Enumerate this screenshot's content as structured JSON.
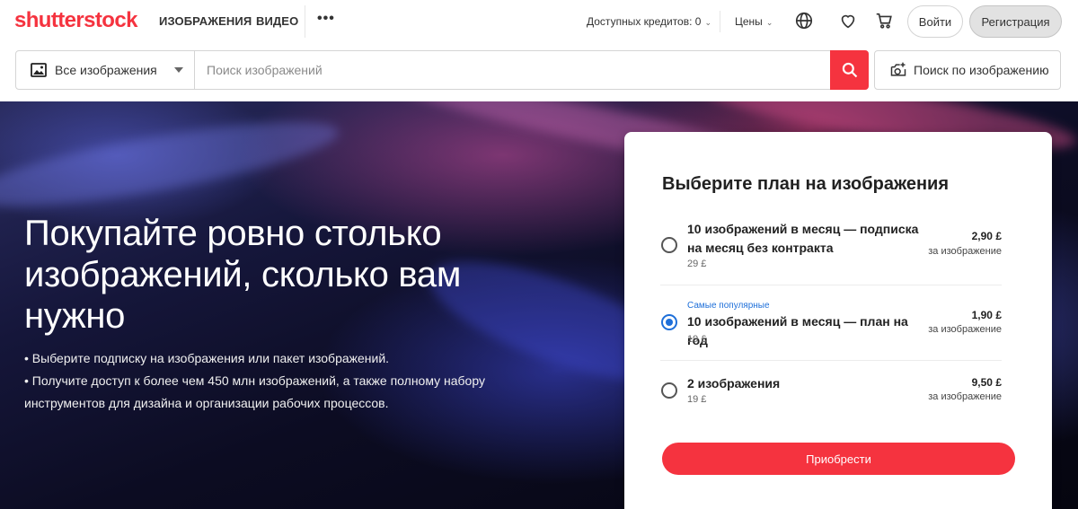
{
  "header": {
    "logo_text": "shutterstock",
    "nav": [
      "ИЗОБРАЖЕНИЯ",
      "ВИДЕО"
    ],
    "more_label": "•••",
    "credits_label": "Доступных кредитов: 0",
    "pricing_label": "Цены",
    "login_label": "Войти",
    "register_label": "Регистрация"
  },
  "search": {
    "type_label": "Все изображения",
    "placeholder": "Поиск изображений",
    "image_search_label": "Поиск по изображению"
  },
  "hero": {
    "title": "Покупайте ровно столько изображений, сколько вам нужно",
    "bullets": [
      "• Выберите подписку на изображения или пакет изображений.",
      "• Получите доступ к более чем 450 млн изображений, а также полному набору инструментов для дизайна и организации рабочих процессов."
    ]
  },
  "plans": {
    "title": "Выберите план на изображения",
    "options": [
      {
        "badge": "",
        "name": "10 изображений в месяц — подписка на месяц без контракта",
        "total": "29 £",
        "price": "2,90 £",
        "per": "за изображение",
        "selected": false
      },
      {
        "badge": "Самые популярные",
        "name": "10 изображений в месяц — план на год",
        "total": "19 £",
        "price": "1,90 £",
        "per": "за изображение",
        "selected": true
      },
      {
        "badge": "",
        "name": "2 изображения",
        "total": "19 £",
        "price": "9,50 £",
        "per": "за изображение",
        "selected": false
      }
    ],
    "buy_label": "Приобрести"
  },
  "colors": {
    "brand_red": "#f5333f",
    "accent_blue": "#1e6fd9"
  }
}
